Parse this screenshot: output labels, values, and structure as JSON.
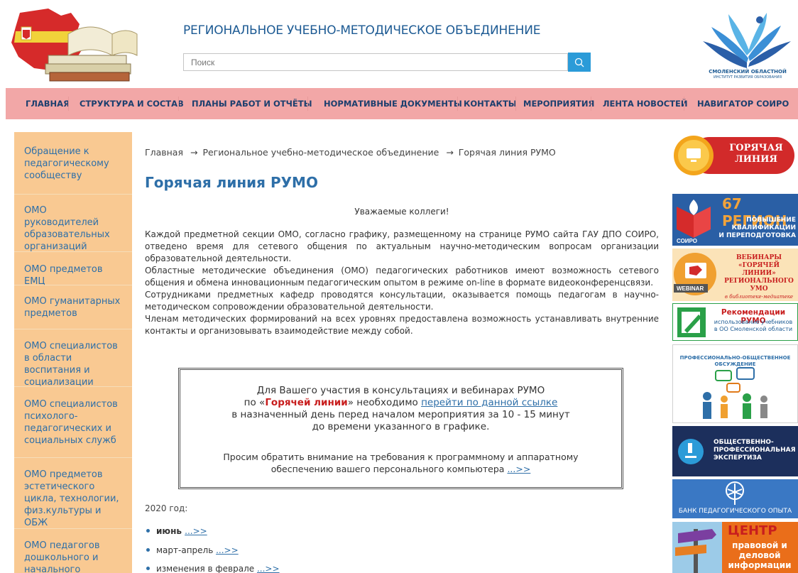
{
  "header": {
    "site_title": "РЕГИОНАЛЬНОЕ УЧЕБНО-МЕТОДИЧЕСКОЕ ОБЪЕДИНЕНИЕ",
    "search_placeholder": "Поиск",
    "logo_right_line1": "СМОЛЕНСКИЙ ОБЛАСТНОЙ",
    "logo_right_line2": "ИНСТИТУТ РАЗВИТИЯ ОБРАЗОВАНИЯ"
  },
  "nav": {
    "items": [
      "ГЛАВНАЯ",
      "СТРУКТУРА И СОСТАВ",
      "ПЛАНЫ РАБОТ И ОТЧЁТЫ",
      "НОРМАТИВНЫЕ ДОКУМЕНТЫ",
      "КОНТАКТЫ",
      "МЕРОПРИЯТИЯ",
      "ЛЕНТА НОВОСТЕЙ",
      "НАВИГАТОР СОИРО"
    ]
  },
  "sidebar": {
    "items": [
      "Обращение к педагогическому сообществу",
      "ОМО руководителей образовательных организаций",
      "ОМО предметов ЕМЦ",
      "ОМО гуманитарных предметов",
      "ОМО специалистов в области воспитания и социализации",
      "ОМО специалистов психолого-педагогических и социальных служб",
      "ОМО предметов эстетического цикла, технологии, физ.культуры и ОБЖ",
      "ОМО педагогов дошкольного и начального образования"
    ]
  },
  "breadcrumb": {
    "home": "Главная",
    "arrow": "→",
    "section": "Региональное учебно-методическое объединение",
    "current": "Горячая линия РУМО"
  },
  "main": {
    "title": "Горячая линия РУМО",
    "greeting": "Уважаемые коллеги!",
    "paragraphs": [
      "Каждой предметной секции ОМО, согласно графику, размещенному на странице РУМО сайта ГАУ ДПО СОИРО, отведено время для сетевого общения по актуальным научно-методическим вопросам организации образовательной деятельности.",
      "Областные методические объединения (ОМО) педагогических работников имеют возможность сетевого общения и обмена инновационным педагогическим опытом в режиме on-line в формате видеоконференцсвязи.",
      "Сотрудниками предметных кафедр проводятся консультации, оказывается помощь педагогам в научно-методическом сопровождении образовательной деятельности.",
      "Членам методических формирований на всех уровнях предоставлена возможность устанавливать внутренние контакты и организовывать взаимодействие между собой."
    ]
  },
  "notice": {
    "line1": "Для Вашего участия в консультациях и вебинарах РУМО",
    "line2_pre": "по «",
    "line2_red": "Горячей линии",
    "line2_mid": "» необходимо ",
    "line2_link": "перейти по данной ссылке",
    "line3": "в назначенный день перед началом мероприятия за 10 - 15 минут",
    "line4": "до времени указанного в графике.",
    "line5": "Просим обратить внимание на требования к программному и аппаратному",
    "line6_pre": "обеспечению вашего персонального компьютера ",
    "line6_link": "...>>"
  },
  "year": {
    "label": "2020 год:",
    "items": [
      {
        "text": "июнь ",
        "link": "...>>"
      },
      {
        "text": "март-апрель ",
        "link": "...>>"
      },
      {
        "text": "изменения в феврале ",
        "link": "...>>"
      }
    ]
  },
  "banners": {
    "hotline_l1": "ГОРЯЧАЯ",
    "hotline_l2": "ЛИНИЯ",
    "region_title": "67 РЕГИОН",
    "region_l1": "ПОВЫШЕНИЕ",
    "region_l2": "КВАЛИФИКАЦИИ",
    "region_l3": "И ПЕРЕПОДГОТОВКА",
    "region_soiro": "СОИРО",
    "webinar_l1": "ВЕБИНАРЫ",
    "webinar_l2": "«ГОРЯЧЕЙ ЛИНИИ»",
    "webinar_l3": "РЕГИОНАЛЬНОГО",
    "webinar_l4": "УМО",
    "webinar_l5": "в библиотеке-медиатеке",
    "webinar_badge": "WEBINAR",
    "rec_title": "Рекомендации РУМО",
    "rec_l1": "использование учебников",
    "rec_l2": "в ОО Смоленской области",
    "discussion_l1": "ПРОФЕССИОНАЛЬНО-ОБЩЕСТВЕННОЕ",
    "discussion_l2": "ОБСУЖДЕНИЕ",
    "expertise_l1": "ОБЩЕСТВЕННО-",
    "expertise_l2": "ПРОФЕССИОНАЛЬНАЯ",
    "expertise_l3": "ЭКСПЕРТИЗА",
    "bank": "БАНК ПЕДАГОГИЧЕСКОГО ОПЫТА",
    "center_title": "ЦЕНТР",
    "center_l1": "правовой и",
    "center_l2": "деловой",
    "center_l3": "информации"
  },
  "colors": {
    "nav_bg": "#f2a7a7",
    "sidebar_bg": "#f9c992",
    "link": "#2e6fa8",
    "search_button": "#2b9bd8"
  }
}
